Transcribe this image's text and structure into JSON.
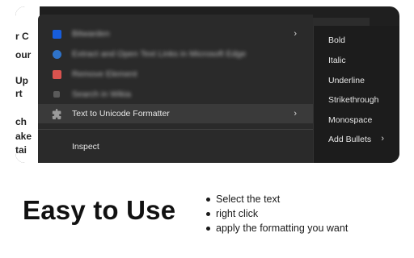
{
  "page_behind": {
    "fragments": [
      "r C",
      "our",
      "Up",
      "rt",
      "ch",
      "ake",
      "tai"
    ]
  },
  "context_menu": {
    "items": [
      {
        "label": "Bitwarden",
        "icon": "bitwarden-icon",
        "blurred": true,
        "has_submenu": true
      },
      {
        "label": "Extract and Open Text Links in Microsoft Edge",
        "icon": "edge-icon",
        "blurred": true,
        "has_submenu": false
      },
      {
        "label": "Remove Element",
        "icon": "red-extension-icon",
        "blurred": true,
        "has_submenu": false
      },
      {
        "label": "Search in Wikia",
        "icon": "search-icon",
        "blurred": true,
        "has_submenu": false
      },
      {
        "label": "Text to Unicode Formatter",
        "icon": "puzzle-piece-icon",
        "blurred": false,
        "has_submenu": true,
        "highlighted": true
      },
      {
        "label": "Inspect",
        "icon": "",
        "blurred": false,
        "has_submenu": false
      }
    ],
    "chevron": "›"
  },
  "submenu": {
    "items": [
      "Bold",
      "Italic",
      "Underline",
      "Strikethrough",
      "Monospace",
      "Add Bullets"
    ],
    "chevron": "›"
  },
  "promo": {
    "headline": "Easy to Use",
    "steps": [
      "Select the text",
      "right click",
      "apply the formatting you want"
    ]
  },
  "colors": {
    "menu_bg": "#2a2a2a",
    "submenu_bg": "#1c1c1c",
    "highlight_bg": "#3a3a3a",
    "menu_text": "#e8e8e8"
  }
}
